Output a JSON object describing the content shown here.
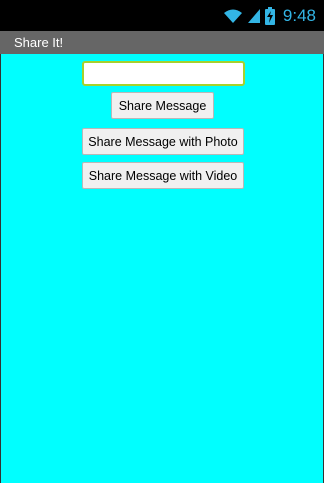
{
  "status_bar": {
    "time": "9:48",
    "icons": [
      "wifi-icon",
      "signal-icon",
      "battery-charging-icon"
    ],
    "accent_color": "#33b5e5"
  },
  "app": {
    "title": "Share It!",
    "title_bar_color": "#666666",
    "background_color": "#00ffff"
  },
  "form": {
    "message_value": "",
    "message_placeholder": ""
  },
  "buttons": {
    "share_message": "Share Message",
    "share_photo": "Share Message with Photo",
    "share_video": "Share Message with Video"
  }
}
